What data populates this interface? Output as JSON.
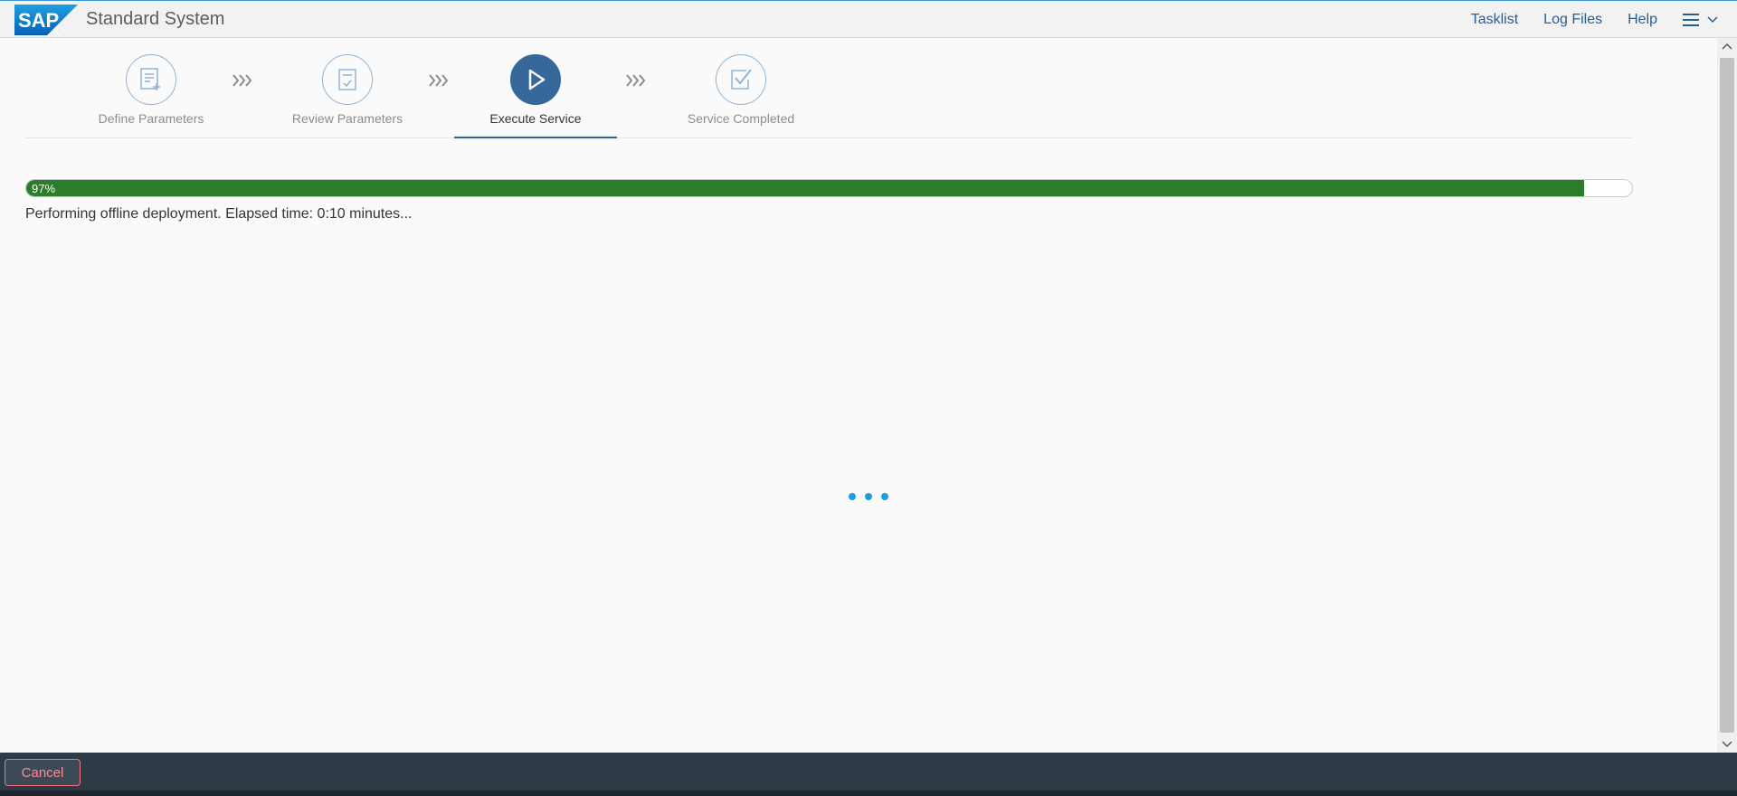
{
  "header": {
    "logo_text": "SAP",
    "title": "Standard System",
    "links": [
      "Tasklist",
      "Log Files",
      "Help"
    ]
  },
  "wizard": {
    "steps": [
      {
        "label": "Define Parameters",
        "icon": "document-add-icon",
        "state": "done"
      },
      {
        "label": "Review Parameters",
        "icon": "document-check-icon",
        "state": "done"
      },
      {
        "label": "Execute Service",
        "icon": "play-icon",
        "state": "active"
      },
      {
        "label": "Service Completed",
        "icon": "checkbox-icon",
        "state": "pending"
      }
    ]
  },
  "progress": {
    "percent": 97,
    "label": "97%",
    "fill_color": "#2b7d2b",
    "status": "Performing offline deployment. Elapsed time: 0:10 minutes..."
  },
  "footer": {
    "cancel_label": "Cancel"
  },
  "colors": {
    "accent": "#36689a",
    "busy_indicator": "#1a9ee0"
  }
}
